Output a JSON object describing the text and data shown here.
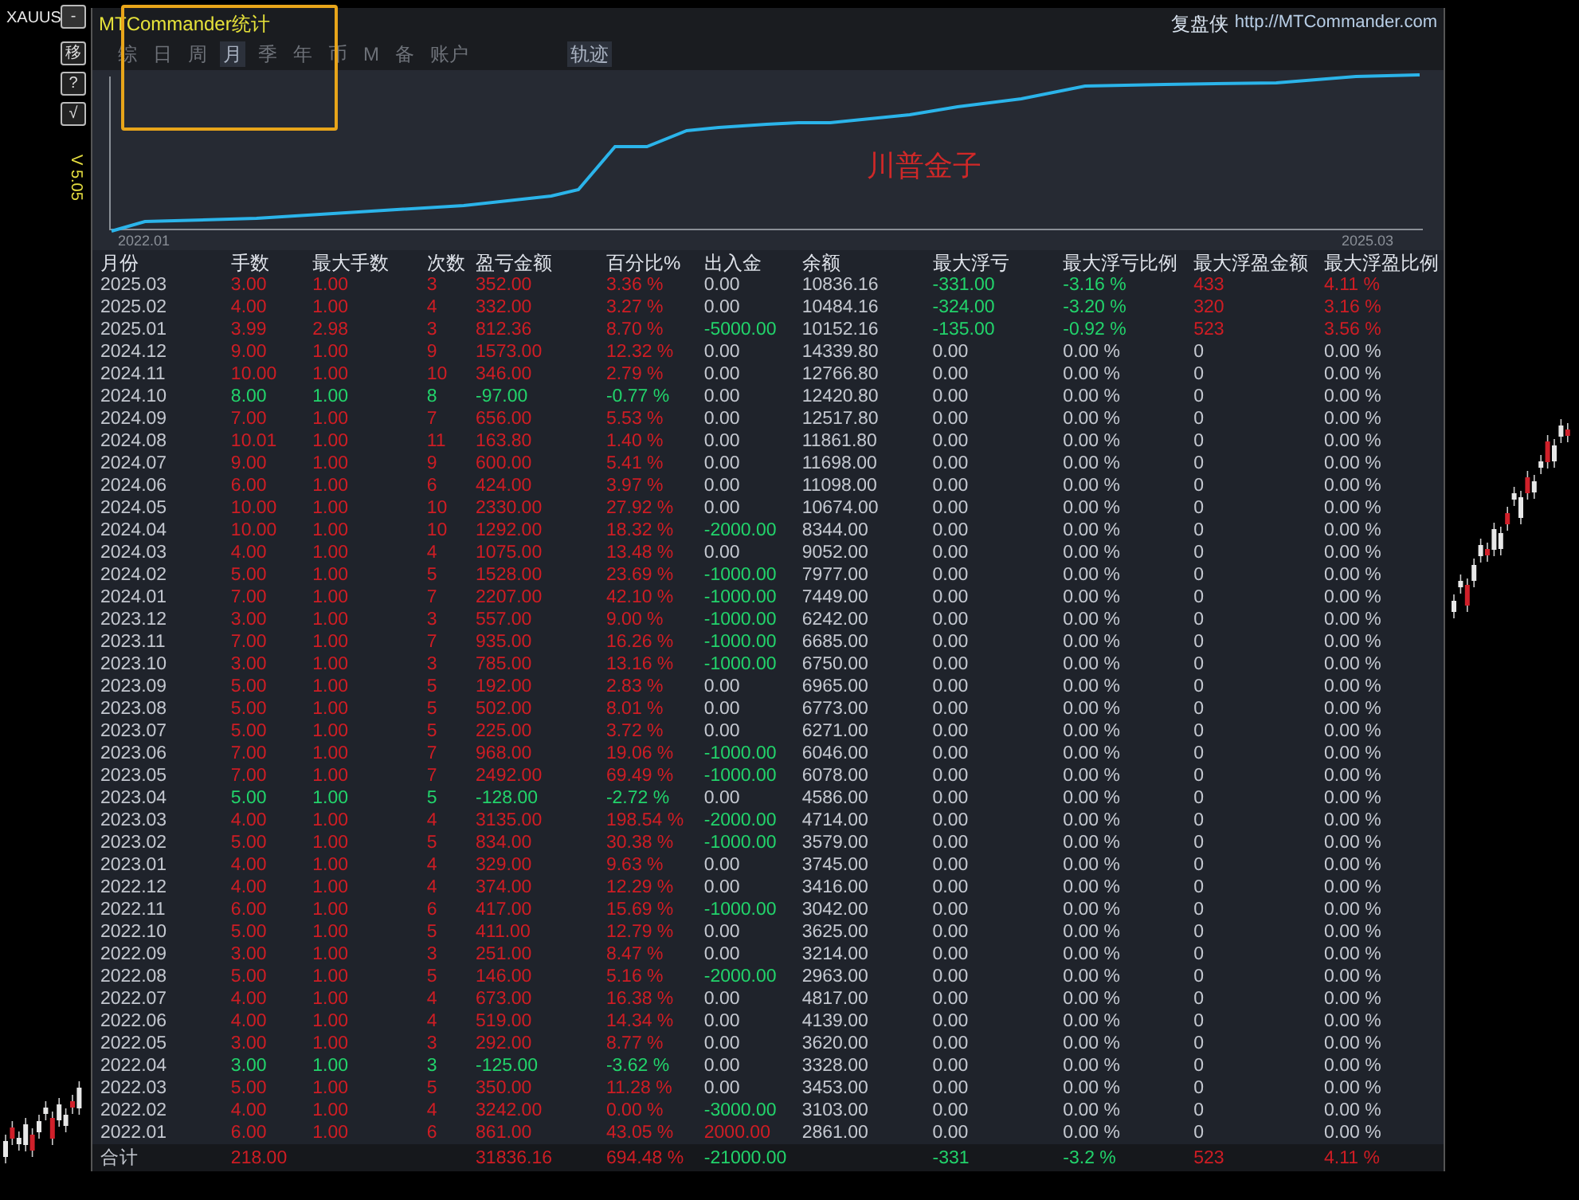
{
  "side_toolbar": {
    "symbol": "XAUUS",
    "buttons": [
      "-",
      "移",
      "?",
      "√"
    ],
    "version": "V 5.05"
  },
  "panel": {
    "title": "MTCommander统计",
    "brand": "复盘侠",
    "url": "http://MTCommander.com"
  },
  "tabs": [
    {
      "label": "综",
      "selected": false
    },
    {
      "label": "日",
      "selected": false
    },
    {
      "label": "周",
      "selected": false
    },
    {
      "label": "月",
      "selected": true
    },
    {
      "label": "季",
      "selected": false
    },
    {
      "label": "年",
      "selected": false
    },
    {
      "label": "币",
      "selected": false
    },
    {
      "label": "M",
      "selected": false
    },
    {
      "label": "备",
      "selected": false
    },
    {
      "label": "账户",
      "selected": false
    }
  ],
  "view_toggles": [
    {
      "label": "轨迹",
      "selected": true
    }
  ],
  "equity_chart": {
    "start_label": "2022.01",
    "end_label": "2025.03",
    "note": "川普金子"
  },
  "table": {
    "columns": [
      "月份",
      "手数",
      "最大手数",
      "次数",
      "盈亏金额",
      "百分比%",
      "出入金",
      "余额",
      "最大浮亏",
      "最大浮亏比例",
      "最大浮盈金额",
      "最大浮盈比例"
    ],
    "rows": [
      {
        "cells": [
          "2025.03",
          "3.00",
          "1.00",
          "3",
          "352.00",
          "3.36 %",
          "0.00",
          "10836.16",
          "-331.00",
          "-3.16 %",
          "433",
          "4.11 %"
        ],
        "loss": false,
        "floating_highlighted": true
      },
      {
        "cells": [
          "2025.02",
          "4.00",
          "1.00",
          "4",
          "332.00",
          "3.27 %",
          "0.00",
          "10484.16",
          "-324.00",
          "-3.20 %",
          "320",
          "3.16 %"
        ],
        "loss": false,
        "floating_highlighted": true
      },
      {
        "cells": [
          "2025.01",
          "3.99",
          "2.98",
          "3",
          "812.36",
          "8.70 %",
          "-5000.00",
          "10152.16",
          "-135.00",
          "-0.92 %",
          "523",
          "3.56 %"
        ],
        "loss": false,
        "color": "#22d36b",
        "floating_highlighted": true
      },
      {
        "cells": [
          "2024.12",
          "9.00",
          "1.00",
          "9",
          "1573.00",
          "12.32 %",
          "0.00",
          "14339.80",
          "0.00",
          "0.00 %",
          "0",
          "0.00 %"
        ],
        "loss": false,
        "floating_highlighted": false
      },
      {
        "cells": [
          "2024.11",
          "10.00",
          "1.00",
          "10",
          "346.00",
          "2.79 %",
          "0.00",
          "12766.80",
          "0.00",
          "0.00 %",
          "0",
          "0.00 %"
        ],
        "loss": false,
        "floating_highlighted": false
      },
      {
        "cells": [
          "2024.10",
          "8.00",
          "1.00",
          "8",
          "-97.00",
          "-0.77 %",
          "0.00",
          "12420.80",
          "0.00",
          "0.00 %",
          "0",
          "0.00 %"
        ],
        "loss": true,
        "floating_highlighted": false
      },
      {
        "cells": [
          "2024.09",
          "7.00",
          "1.00",
          "7",
          "656.00",
          "5.53 %",
          "0.00",
          "12517.80",
          "0.00",
          "0.00 %",
          "0",
          "0.00 %"
        ],
        "loss": false,
        "floating_highlighted": false
      },
      {
        "cells": [
          "2024.08",
          "10.01",
          "1.00",
          "11",
          "163.80",
          "1.40 %",
          "0.00",
          "11861.80",
          "0.00",
          "0.00 %",
          "0",
          "0.00 %"
        ],
        "loss": false,
        "floating_highlighted": false
      },
      {
        "cells": [
          "2024.07",
          "9.00",
          "1.00",
          "9",
          "600.00",
          "5.41 %",
          "0.00",
          "11698.00",
          "0.00",
          "0.00 %",
          "0",
          "0.00 %"
        ],
        "loss": false,
        "floating_highlighted": false
      },
      {
        "cells": [
          "2024.06",
          "6.00",
          "1.00",
          "6",
          "424.00",
          "3.97 %",
          "0.00",
          "11098.00",
          "0.00",
          "0.00 %",
          "0",
          "0.00 %"
        ],
        "loss": false,
        "floating_highlighted": false
      },
      {
        "cells": [
          "2024.05",
          "10.00",
          "1.00",
          "10",
          "2330.00",
          "27.92 %",
          "0.00",
          "10674.00",
          "0.00",
          "0.00 %",
          "0",
          "0.00 %"
        ],
        "loss": false,
        "floating_highlighted": false
      },
      {
        "cells": [
          "2024.04",
          "10.00",
          "1.00",
          "10",
          "1292.00",
          "18.32 %",
          "-2000.00",
          "8344.00",
          "0.00",
          "0.00 %",
          "0",
          "0.00 %"
        ],
        "loss": false,
        "color": "#22d36b",
        "floating_highlighted": false
      },
      {
        "cells": [
          "2024.03",
          "4.00",
          "1.00",
          "4",
          "1075.00",
          "13.48 %",
          "0.00",
          "9052.00",
          "0.00",
          "0.00 %",
          "0",
          "0.00 %"
        ],
        "loss": false,
        "floating_highlighted": false
      },
      {
        "cells": [
          "2024.02",
          "5.00",
          "1.00",
          "5",
          "1528.00",
          "23.69 %",
          "-1000.00",
          "7977.00",
          "0.00",
          "0.00 %",
          "0",
          "0.00 %"
        ],
        "loss": false,
        "color": "#22d36b",
        "floating_highlighted": false
      },
      {
        "cells": [
          "2024.01",
          "7.00",
          "1.00",
          "7",
          "2207.00",
          "42.10 %",
          "-1000.00",
          "7449.00",
          "0.00",
          "0.00 %",
          "0",
          "0.00 %"
        ],
        "loss": false,
        "color": "#22d36b",
        "floating_highlighted": false
      },
      {
        "cells": [
          "2023.12",
          "3.00",
          "1.00",
          "3",
          "557.00",
          "9.00 %",
          "-1000.00",
          "6242.00",
          "0.00",
          "0.00 %",
          "0",
          "0.00 %"
        ],
        "loss": false,
        "color": "#22d36b",
        "floating_highlighted": false
      },
      {
        "cells": [
          "2023.11",
          "7.00",
          "1.00",
          "7",
          "935.00",
          "16.26 %",
          "-1000.00",
          "6685.00",
          "0.00",
          "0.00 %",
          "0",
          "0.00 %"
        ],
        "loss": false,
        "color": "#22d36b",
        "floating_highlighted": false
      },
      {
        "cells": [
          "2023.10",
          "3.00",
          "1.00",
          "3",
          "785.00",
          "13.16 %",
          "-1000.00",
          "6750.00",
          "0.00",
          "0.00 %",
          "0",
          "0.00 %"
        ],
        "loss": false,
        "color": "#22d36b",
        "floating_highlighted": false
      },
      {
        "cells": [
          "2023.09",
          "5.00",
          "1.00",
          "5",
          "192.00",
          "2.83 %",
          "0.00",
          "6965.00",
          "0.00",
          "0.00 %",
          "0",
          "0.00 %"
        ],
        "loss": false,
        "floating_highlighted": false
      },
      {
        "cells": [
          "2023.08",
          "5.00",
          "1.00",
          "5",
          "502.00",
          "8.01 %",
          "0.00",
          "6773.00",
          "0.00",
          "0.00 %",
          "0",
          "0.00 %"
        ],
        "loss": false,
        "floating_highlighted": false
      },
      {
        "cells": [
          "2023.07",
          "5.00",
          "1.00",
          "5",
          "225.00",
          "3.72 %",
          "0.00",
          "6271.00",
          "0.00",
          "0.00 %",
          "0",
          "0.00 %"
        ],
        "loss": false,
        "floating_highlighted": false
      },
      {
        "cells": [
          "2023.06",
          "7.00",
          "1.00",
          "7",
          "968.00",
          "19.06 %",
          "-1000.00",
          "6046.00",
          "0.00",
          "0.00 %",
          "0",
          "0.00 %"
        ],
        "loss": false,
        "color": "#22d36b",
        "floating_highlighted": false
      },
      {
        "cells": [
          "2023.05",
          "7.00",
          "1.00",
          "7",
          "2492.00",
          "69.49 %",
          "-1000.00",
          "6078.00",
          "0.00",
          "0.00 %",
          "0",
          "0.00 %"
        ],
        "loss": false,
        "color": "#22d36b",
        "floating_highlighted": false
      },
      {
        "cells": [
          "2023.04",
          "5.00",
          "1.00",
          "5",
          "-128.00",
          "-2.72 %",
          "0.00",
          "4586.00",
          "0.00",
          "0.00 %",
          "0",
          "0.00 %"
        ],
        "loss": true,
        "floating_highlighted": false
      },
      {
        "cells": [
          "2023.03",
          "4.00",
          "1.00",
          "4",
          "3135.00",
          "198.54 %",
          "-2000.00",
          "4714.00",
          "0.00",
          "0.00 %",
          "0",
          "0.00 %"
        ],
        "loss": false,
        "color": "#22d36b",
        "floating_highlighted": false
      },
      {
        "cells": [
          "2023.02",
          "5.00",
          "1.00",
          "5",
          "834.00",
          "30.38 %",
          "-1000.00",
          "3579.00",
          "0.00",
          "0.00 %",
          "0",
          "0.00 %"
        ],
        "loss": false,
        "color": "#22d36b",
        "floating_highlighted": false
      },
      {
        "cells": [
          "2023.01",
          "4.00",
          "1.00",
          "4",
          "329.00",
          "9.63 %",
          "0.00",
          "3745.00",
          "0.00",
          "0.00 %",
          "0",
          "0.00 %"
        ],
        "loss": false,
        "floating_highlighted": false
      },
      {
        "cells": [
          "2022.12",
          "4.00",
          "1.00",
          "4",
          "374.00",
          "12.29 %",
          "0.00",
          "3416.00",
          "0.00",
          "0.00 %",
          "0",
          "0.00 %"
        ],
        "loss": false,
        "floating_highlighted": false
      },
      {
        "cells": [
          "2022.11",
          "6.00",
          "1.00",
          "6",
          "417.00",
          "15.69 %",
          "-1000.00",
          "3042.00",
          "0.00",
          "0.00 %",
          "0",
          "0.00 %"
        ],
        "loss": false,
        "color": "#22d36b",
        "floating_highlighted": false
      },
      {
        "cells": [
          "2022.10",
          "5.00",
          "1.00",
          "5",
          "411.00",
          "12.79 %",
          "0.00",
          "3625.00",
          "0.00",
          "0.00 %",
          "0",
          "0.00 %"
        ],
        "loss": false,
        "floating_highlighted": false
      },
      {
        "cells": [
          "2022.09",
          "3.00",
          "1.00",
          "3",
          "251.00",
          "8.47 %",
          "0.00",
          "3214.00",
          "0.00",
          "0.00 %",
          "0",
          "0.00 %"
        ],
        "loss": false,
        "floating_highlighted": false
      },
      {
        "cells": [
          "2022.08",
          "5.00",
          "1.00",
          "5",
          "146.00",
          "5.16 %",
          "-2000.00",
          "2963.00",
          "0.00",
          "0.00 %",
          "0",
          "0.00 %"
        ],
        "loss": false,
        "color": "#22d36b",
        "floating_highlighted": false
      },
      {
        "cells": [
          "2022.07",
          "4.00",
          "1.00",
          "4",
          "673.00",
          "16.38 %",
          "0.00",
          "4817.00",
          "0.00",
          "0.00 %",
          "0",
          "0.00 %"
        ],
        "loss": false,
        "floating_highlighted": false
      },
      {
        "cells": [
          "2022.06",
          "4.00",
          "1.00",
          "4",
          "519.00",
          "14.34 %",
          "0.00",
          "4139.00",
          "0.00",
          "0.00 %",
          "0",
          "0.00 %"
        ],
        "loss": false,
        "floating_highlighted": false
      },
      {
        "cells": [
          "2022.05",
          "3.00",
          "1.00",
          "3",
          "292.00",
          "8.77 %",
          "0.00",
          "3620.00",
          "0.00",
          "0.00 %",
          "0",
          "0.00 %"
        ],
        "loss": false,
        "floating_highlighted": false
      },
      {
        "cells": [
          "2022.04",
          "3.00",
          "1.00",
          "3",
          "-125.00",
          "-3.62 %",
          "0.00",
          "3328.00",
          "0.00",
          "0.00 %",
          "0",
          "0.00 %"
        ],
        "loss": true,
        "floating_highlighted": false
      },
      {
        "cells": [
          "2022.03",
          "5.00",
          "1.00",
          "5",
          "350.00",
          "11.28 %",
          "0.00",
          "3453.00",
          "0.00",
          "0.00 %",
          "0",
          "0.00 %"
        ],
        "loss": false,
        "floating_highlighted": false
      },
      {
        "cells": [
          "2022.02",
          "4.00",
          "1.00",
          "4",
          "3242.00",
          "0.00 %",
          "-3000.00",
          "3103.00",
          "0.00",
          "0.00 %",
          "0",
          "0.00 %"
        ],
        "loss": false,
        "color": "#22d36b",
        "floating_highlighted": false
      },
      {
        "cells": [
          "2022.01",
          "6.00",
          "1.00",
          "6",
          "861.00",
          "43.05 %",
          "2000.00",
          "2861.00",
          "0.00",
          "0.00 %",
          "0",
          "0.00 %"
        ],
        "loss": false,
        "color": "#cf1d24",
        "floating_highlighted": false
      }
    ],
    "total": {
      "cells": [
        "合计",
        "218.00",
        "",
        "",
        "31836.16",
        "694.48 %",
        "-21000.00",
        "",
        "-331",
        "-3.2 %",
        "523",
        "4.11 %"
      ],
      "loss": false,
      "color": "#22d36b",
      "floating_highlighted": true
    }
  }
}
